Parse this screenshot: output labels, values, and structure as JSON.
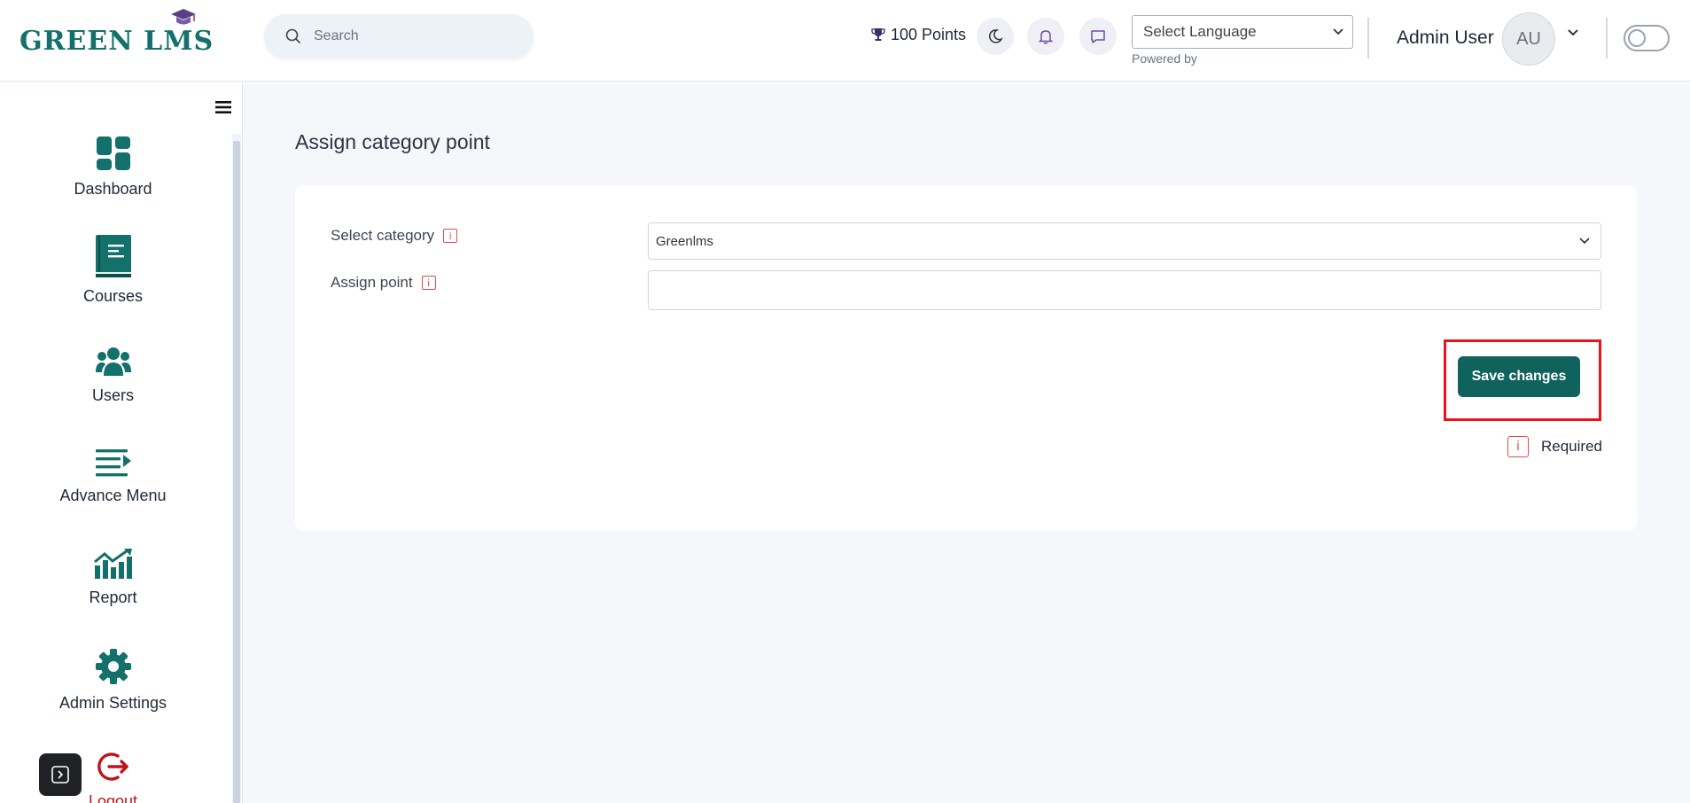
{
  "header": {
    "logo": {
      "part1": "GREEN L",
      "part2": "MS"
    },
    "search": {
      "placeholder": "Search"
    },
    "points": "100 Points",
    "language": {
      "selected": "Select Language",
      "powered_by": "Powered by"
    },
    "user": {
      "name": "Admin User",
      "initials": "AU"
    }
  },
  "sidebar": {
    "items": [
      {
        "label": "Dashboard",
        "icon": "dashboard-icon"
      },
      {
        "label": "Courses",
        "icon": "book-icon"
      },
      {
        "label": "Users",
        "icon": "users-icon"
      },
      {
        "label": "Advance Menu",
        "icon": "menu-lines-icon"
      },
      {
        "label": "Report",
        "icon": "chart-icon"
      },
      {
        "label": "Admin Settings",
        "icon": "gear-icon"
      },
      {
        "label": "Logout",
        "icon": "logout-icon"
      }
    ]
  },
  "main": {
    "title": "Assign category point",
    "form": {
      "category_label": "Select category",
      "category_value": "Greenlms",
      "point_label": "Assign point",
      "point_value": "",
      "save_label": "Save changes",
      "required_label": "Required",
      "info_glyph": "i"
    }
  },
  "colors": {
    "brand": "#13706a",
    "button": "#10625c",
    "highlight": "#e8141c",
    "logout": "#c0141c",
    "info": "#e04a50"
  }
}
